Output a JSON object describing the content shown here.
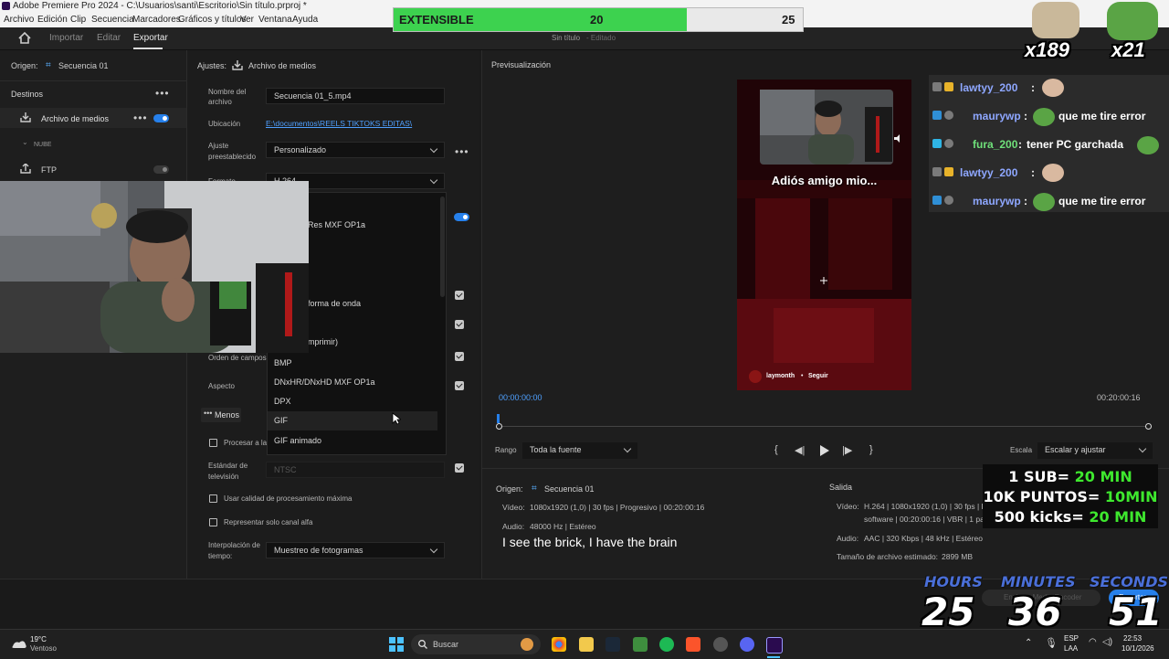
{
  "window": {
    "title": "Adobe Premiere Pro 2024 - C:\\Usuarios\\santi\\Escritorio\\Sin título.prproj *",
    "menu": [
      "Archivo",
      "Edición",
      "Clip",
      "Secuencia",
      "Marcadores",
      "Gráficos y títulos",
      "Ver",
      "Ventana",
      "Ayuda"
    ]
  },
  "header": {
    "tabs": [
      "Importar",
      "Editar",
      "Exportar"
    ],
    "active_tab": "Exportar",
    "project_name": "Sin título",
    "project_status": "- Editado"
  },
  "left": {
    "origin_label": "Origen:",
    "origin_value": "Secuencia 01",
    "destinations_title": "Destinos",
    "media_file": "Archivo de medios",
    "cloud": "NUBE",
    "ftp": "FTP"
  },
  "settings": {
    "title": "Ajustes:",
    "title_value": "Archivo de medios",
    "filename_label": "Nombre del archivo",
    "filename_value": "Secuencia 01_5.mp4",
    "location_label": "Ubicación",
    "location_value": "E:\\documentos\\REELS TIKTOKS EDITAS\\",
    "preset_label": "Ajuste preestablecido",
    "preset_value": "Personalizado",
    "format_label": "Formato",
    "format_value": "H.264",
    "field_order_label": "Orden de campos",
    "aspect_label": "Aspecto",
    "less_button": "Menos",
    "render_at_max": "Procesar a la m",
    "tv_standard_label": "Estándar de televisión",
    "tv_standard_value": "NTSC",
    "max_quality": "Usar calidad de procesamiento máxima",
    "alpha_only": "Representar solo canal alfa",
    "interp_label": "Interpolación de tiempo:",
    "interp_value": "Muestreo de fotogramas"
  },
  "dropdown": {
    "partial_items": [
      "Res MXF OP1a",
      "forma de onda",
      "mprimir)"
    ],
    "items": [
      "BMP",
      "DNxHR/DNxHD MXF OP1a",
      "DPX",
      "GIF",
      "GIF animado"
    ]
  },
  "preview": {
    "title": "Previsualización",
    "caption": "Adiós amigo mio...",
    "account": "laymonth",
    "follow": "Seguir",
    "time_start": "00:00:00:00",
    "time_end": "00:20:00:16",
    "range_label": "Rango",
    "range_value": "Toda la fuente",
    "scale_label": "Escala",
    "scale_value": "Escalar y ajustar"
  },
  "source_info": {
    "origin_label": "Origen:",
    "origin_value": "Secuencia 01",
    "video_label": "Vídeo:",
    "video_value": "1080x1920 (1,0)  |  30 fps  |  Progresivo  |  00:20:00:16",
    "audio_label": "Audio:",
    "audio_value": "48000 Hz  |  Estéreo"
  },
  "output_info": {
    "title": "Salida",
    "video_label": "Vídeo:",
    "video_value_1": "H.264  |  1080x1920 (1,0)  |  30 fps  |  Pr",
    "video_value_2": "software  |  00:20:00:16  |  VBR  |  1 pa",
    "audio_label": "Audio:",
    "audio_value": "AAC  |  320 Kbps  |  48 kHz  |  Estéreo",
    "size_label": "Tamaño de archivo estimado:",
    "size_value": "2899 MB"
  },
  "subtitle": "I see the brick, I have the brain",
  "export": {
    "send_label": "Enviar a Media Encoder",
    "export_label": "Exportar"
  },
  "stream": {
    "extensible_label": "EXTENSIBLE",
    "extensible_value": "20",
    "extensible_max": "25",
    "extensible_progress": 0.8,
    "badge_1": "x189",
    "badge_2": "x21",
    "chat": [
      {
        "user": "lawtyy_200",
        "sep": ":",
        "msg": ""
      },
      {
        "user": "maurywp",
        "sep": ":",
        "msg": "que me tire error"
      },
      {
        "user": "fura_200",
        "sep": ":",
        "msg": "tener PC garchada"
      },
      {
        "user": "lawtyy_200",
        "sep": ":",
        "msg": ""
      },
      {
        "user": "maurywp",
        "sep": ":",
        "msg": "que me tire error"
      }
    ],
    "subs_line1_a": "1 SUB=",
    "subs_line1_b": "20 MIN",
    "subs_line2_a": "10K PUNTOS=",
    "subs_line2_b": "10MIN",
    "subs_line3_a": "500 kicks=",
    "subs_line3_b": "20 MIN",
    "hours_label": "HOURS",
    "minutes_label": "MINUTES",
    "seconds_label": "SECONDS",
    "hours": "25",
    "minutes": "36",
    "seconds": "51"
  },
  "taskbar": {
    "weather_temp": "19°C",
    "weather_desc": "Ventoso",
    "search": "Buscar",
    "lang_1": "ESP",
    "lang_2": "LAA",
    "time": "22:53",
    "date": "10/1/2026"
  }
}
